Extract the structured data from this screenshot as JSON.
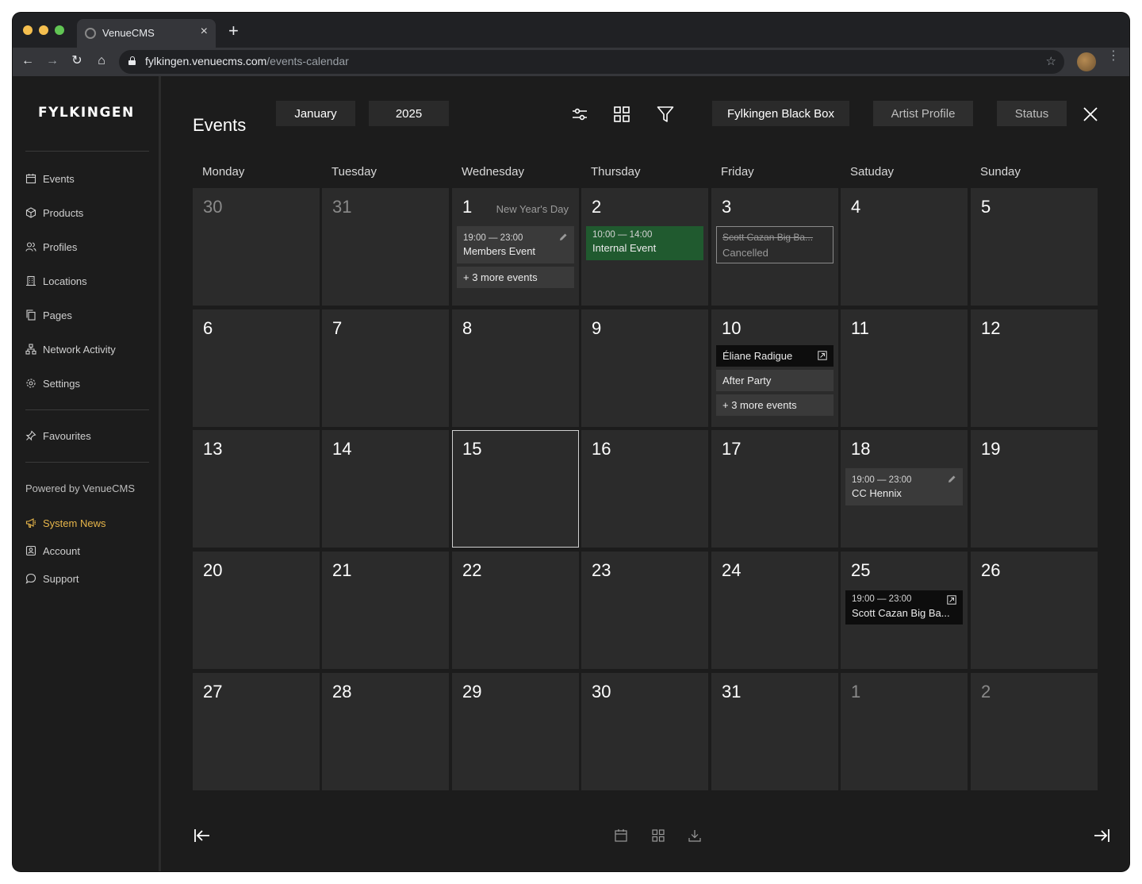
{
  "browser": {
    "tab_title": "VenueCMS",
    "tab_close": "×",
    "new_tab": "+",
    "url_host": "fylkingen.venuecms.com",
    "url_path": "/events-calendar",
    "back": "←",
    "forward": "→",
    "reload": "↻",
    "home": "⌂",
    "star": "☆",
    "menu": "⋮"
  },
  "sidebar": {
    "logo": "FYLKINGEN",
    "nav": [
      {
        "label": "Events",
        "icon": "calendar-icon"
      },
      {
        "label": "Products",
        "icon": "box-icon"
      },
      {
        "label": "Profiles",
        "icon": "users-icon"
      },
      {
        "label": "Locations",
        "icon": "building-icon"
      },
      {
        "label": "Pages",
        "icon": "pages-icon"
      },
      {
        "label": "Network Activity",
        "icon": "network-icon"
      },
      {
        "label": "Settings",
        "icon": "gear-icon"
      }
    ],
    "favourites": "Favourites",
    "powered_by": "Powered by VenueCMS",
    "system_news": "System News",
    "account": "Account",
    "support": "Support",
    "accent_color": "#e6b54a"
  },
  "header": {
    "title": "Events",
    "month": "January",
    "year": "2025",
    "venue": "Fylkingen Black Box",
    "artist_profile": "Artist Profile",
    "status": "Status"
  },
  "weekdays": [
    "Monday",
    "Tuesday",
    "Wednesday",
    "Thursday",
    "Friday",
    "Satuday",
    "Sunday"
  ],
  "days": [
    "30",
    "31",
    "1",
    "2",
    "3",
    "4",
    "5",
    "6",
    "7",
    "8",
    "9",
    "10",
    "11",
    "12",
    "13",
    "14",
    "15",
    "16",
    "17",
    "18",
    "19",
    "20",
    "21",
    "22",
    "23",
    "24",
    "25",
    "26",
    "27",
    "28",
    "29",
    "30",
    "31",
    "1",
    "2"
  ],
  "holiday": "New Year's Day",
  "events": {
    "jan1_members": {
      "time": "19:00 — 23:00",
      "title": "Members Event"
    },
    "jan1_more": "+ 3 more events",
    "jan2_internal": {
      "time": "10:00 — 14:00",
      "title": "Internal Event"
    },
    "jan3_cancelled": {
      "title": "Scott Cazan Big Ba...",
      "status": "Cancelled"
    },
    "jan10_eliane": "Éliane Radigue",
    "jan10_afterparty": "After Party",
    "jan10_more": "+ 3 more events",
    "jan18_hennix": {
      "time": "19:00 — 23:00",
      "title": "CC Hennix"
    },
    "jan25_scott": {
      "time": "19:00 — 23:00",
      "title": "Scott Cazan Big Ba..."
    }
  },
  "colors": {
    "background": "#1c1c1c",
    "cell": "#2b2b2b",
    "event_gray": "#3a3a3a",
    "event_green": "#205a2f",
    "event_black": "#0d0d0d"
  }
}
